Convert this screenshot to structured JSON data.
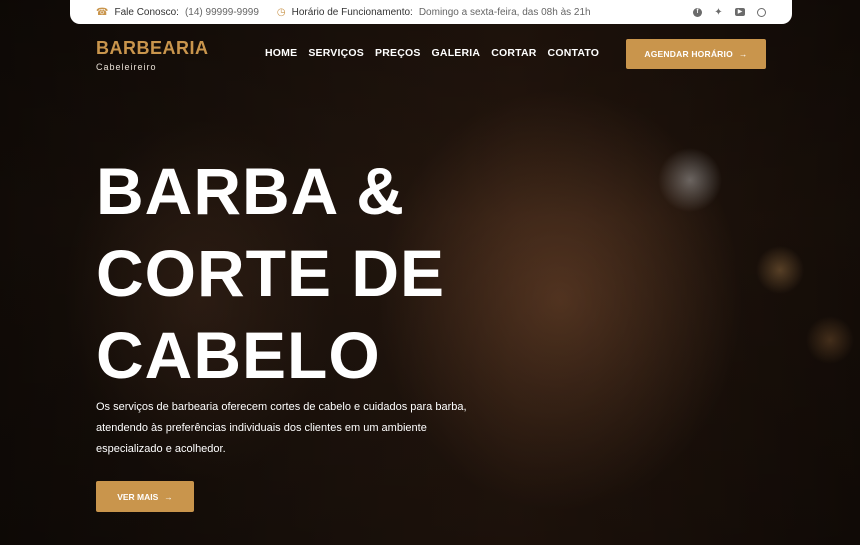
{
  "topbar": {
    "phone_label": "Fale Conosco:",
    "phone_value": "(14) 99999-9999",
    "hours_label": "Horário de Funcionamento:",
    "hours_value": "Domingo a sexta-feira, das 08h às 21h",
    "phone_icon": "phone-icon",
    "clock_icon": "clock-icon",
    "socials": [
      "facebook-icon",
      "twitter-icon",
      "youtube-icon",
      "messenger-icon"
    ]
  },
  "header": {
    "brand": "BARBEARIA",
    "tagline": "Cabeleireiro",
    "nav": [
      "HOME",
      "SERVIÇOS",
      "PREÇOS",
      "GALERIA",
      "CORTAR",
      "CONTATO"
    ],
    "cta_label": "AGENDAR HORÁRIO"
  },
  "hero": {
    "headline_lines": [
      "BARBA &",
      "CORTE DE",
      "CABELO"
    ],
    "description": "Os serviços de barbearia oferecem cortes de cabelo e cuidados para barba, atendendo às preferências individuais dos clientes em um ambiente especializado e acolhedor.",
    "button_label": "VER MAIS"
  },
  "colors": {
    "accent": "#c9954c",
    "text_light": "#ffffff",
    "background": "#1a110b"
  }
}
